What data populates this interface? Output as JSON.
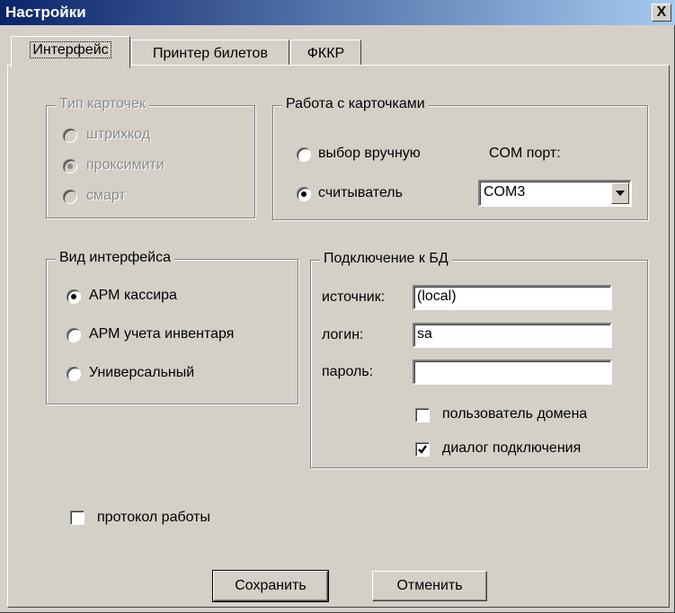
{
  "window": {
    "title": "Настройки",
    "close_label": "X"
  },
  "tabs": [
    {
      "label": "Интерфейс"
    },
    {
      "label": "Принтер билетов"
    },
    {
      "label": "ФККР"
    }
  ],
  "card_type": {
    "legend": "Тип карточек",
    "options": [
      {
        "label": "штрихкод",
        "selected": false
      },
      {
        "label": "проксимити",
        "selected": true
      },
      {
        "label": "смарт",
        "selected": false
      }
    ]
  },
  "card_work": {
    "legend": "Работа с карточками",
    "options": [
      {
        "label": "выбор вручную",
        "selected": false
      },
      {
        "label": "считыватель",
        "selected": true
      }
    ],
    "com_label": "COM порт:",
    "com_value": "COM3"
  },
  "interface_view": {
    "legend": "Вид интерфейса",
    "options": [
      {
        "label": "АРМ кассира",
        "selected": true
      },
      {
        "label": "АРМ учета инвентаря",
        "selected": false
      },
      {
        "label": "Универсальный",
        "selected": false
      }
    ]
  },
  "db": {
    "legend": "Подключение к БД",
    "source_label": "источник:",
    "source_value": "(local)",
    "login_label": "логин:",
    "login_value": "sa",
    "password_label": "пароль:",
    "password_value": "",
    "domain_user_label": "пользователь домена",
    "domain_user_checked": false,
    "connect_dialog_label": "диалог подключения",
    "connect_dialog_checked": true
  },
  "log": {
    "label": "протокол работы",
    "checked": false
  },
  "buttons": {
    "save": "Сохранить",
    "cancel": "Отменить"
  }
}
